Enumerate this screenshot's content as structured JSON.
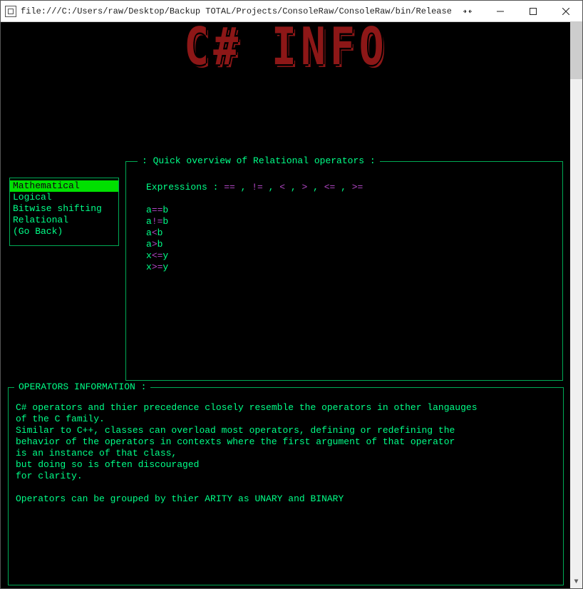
{
  "window": {
    "title": "file:///C:/Users/raw/Desktop/Backup TOTAL/Projects/ConsoleRaw/ConsoleRaw/bin/Release/ConsoleRaw.EXE"
  },
  "logo_text": "C# INFO",
  "menu": {
    "items": [
      {
        "label": "Mathematical",
        "selected": true
      },
      {
        "label": "Logical",
        "selected": false
      },
      {
        "label": "Bitwise shifting",
        "selected": false
      },
      {
        "label": "Relational",
        "selected": false
      },
      {
        "label": "(Go Back)",
        "selected": false
      }
    ]
  },
  "overview": {
    "title": ": Quick overview of Relational operators :",
    "expressions_label": "Expressions : ",
    "operators": [
      "==",
      "!=",
      "<",
      ">",
      "<=",
      ">="
    ],
    "separator": " , ",
    "examples": [
      {
        "lhs": "a",
        "op": "==",
        "rhs": "b"
      },
      {
        "lhs": "a",
        "op": "!=",
        "rhs": "b"
      },
      {
        "lhs": "a",
        "op": "<",
        "rhs": "b"
      },
      {
        "lhs": "a",
        "op": ">",
        "rhs": "b"
      },
      {
        "lhs": "x",
        "op": "<=",
        "rhs": "y"
      },
      {
        "lhs": "x",
        "op": ">=",
        "rhs": "y"
      }
    ]
  },
  "info": {
    "title": "OPERATORS INFORMATION :",
    "body": "C# operators and thier precedence closely resemble the operators in other langauges\nof the C family.\nSimilar to C++, classes can overload most operators, defining or redefining the\nbehavior of the operators in contexts where the first argument of that operator\nis an instance of that class,\nbut doing so is often discouraged\nfor clarity.\n\nOperators can be grouped by thier ARITY as UNARY and BINARY"
  }
}
